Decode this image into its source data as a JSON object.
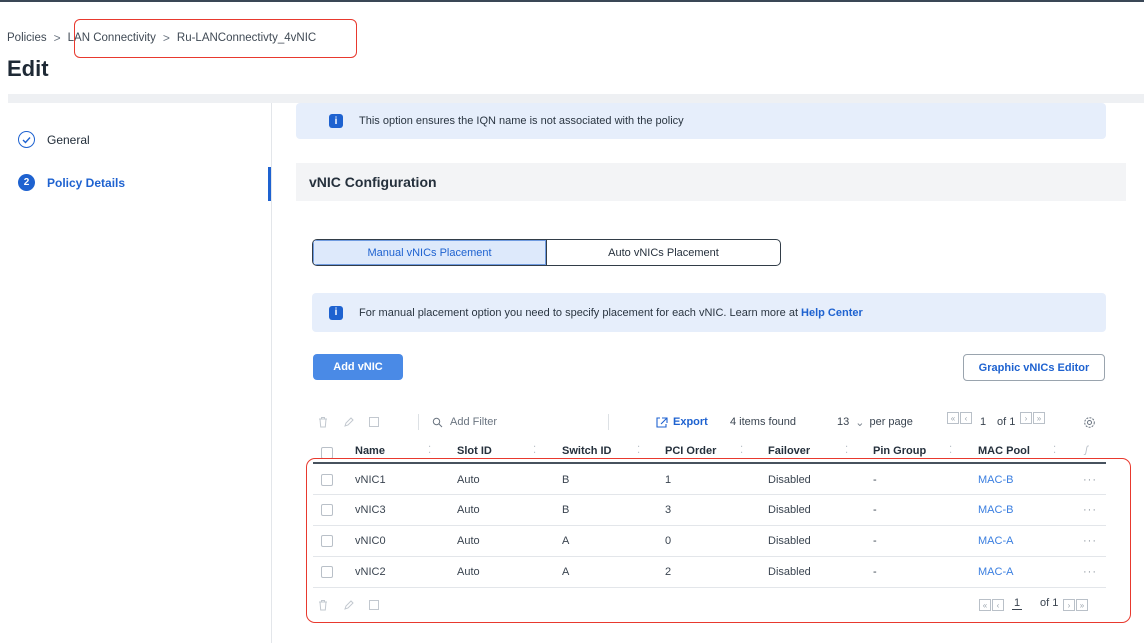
{
  "breadcrumb": {
    "items": [
      "Policies",
      "LAN Connectivity",
      "Ru-LANConnectivty_4vNIC"
    ],
    "separator": ">"
  },
  "page": {
    "title": "Edit"
  },
  "wizard": {
    "steps": [
      {
        "label": "General",
        "state": "done",
        "icon": "check-circle-icon"
      },
      {
        "label": "Policy Details",
        "state": "active",
        "number": "2"
      }
    ]
  },
  "info_iqn": {
    "text": "This option ensures the IQN name is not associated with the policy"
  },
  "section": {
    "title": "vNIC Configuration"
  },
  "placement_toggle": {
    "manual": "Manual vNICs Placement",
    "auto": "Auto vNICs Placement",
    "selected": "manual"
  },
  "info_manual": {
    "text": "For manual placement option you need to specify placement for each vNIC. Learn more at",
    "link": "Help Center"
  },
  "buttons": {
    "add": "Add vNIC",
    "graphic": "Graphic vNICs Editor"
  },
  "table_toolbar": {
    "filter_placeholder": "Add Filter",
    "export": "Export",
    "items_found": "4 items found",
    "per_page_value": "13",
    "per_page_label": "per page",
    "page": "1",
    "page_of": "of 1"
  },
  "table": {
    "columns": [
      "Name",
      "Slot ID",
      "Switch ID",
      "PCI Order",
      "Failover",
      "Pin Group",
      "MAC Pool"
    ],
    "rows": [
      [
        "vNIC1",
        "Auto",
        "B",
        "1",
        "Disabled",
        "-",
        "MAC-B"
      ],
      [
        "vNIC3",
        "Auto",
        "B",
        "3",
        "Disabled",
        "-",
        "MAC-B"
      ],
      [
        "vNIC0",
        "Auto",
        "A",
        "0",
        "Disabled",
        "-",
        "MAC-A"
      ],
      [
        "vNIC2",
        "Auto",
        "A",
        "2",
        "Disabled",
        "-",
        "MAC-A"
      ]
    ],
    "row_action": "···"
  },
  "footer_pager": {
    "page": "1",
    "page_of": "of 1"
  },
  "colors": {
    "accent": "#1e62d0",
    "highlight": "#e8392e",
    "info_bg": "#e6eefb"
  }
}
